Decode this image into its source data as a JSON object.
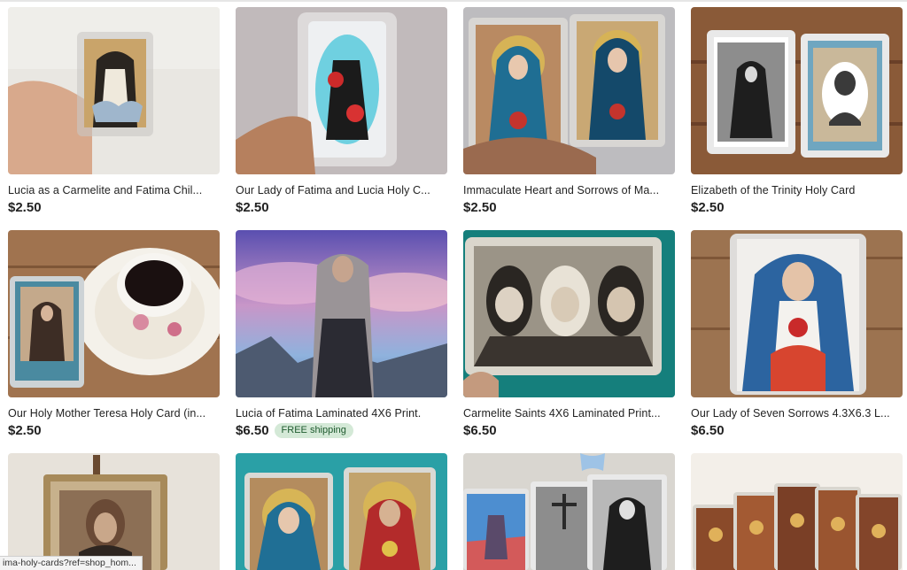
{
  "listings": [
    {
      "title": "Lucia as a Carmelite and Fatima Chil...",
      "price": "$2.50",
      "badge": "",
      "image": "holy-card-lucia-carmelite"
    },
    {
      "title": "Our Lady of Fatima and Lucia Holy C...",
      "price": "$2.50",
      "badge": "",
      "image": "holy-card-our-lady-of-fatima"
    },
    {
      "title": "Immaculate Heart and Sorrows of Ma...",
      "price": "$2.50",
      "badge": "",
      "image": "holy-card-immaculate-heart"
    },
    {
      "title": "Elizabeth of the Trinity Holy Card",
      "price": "$2.50",
      "badge": "",
      "image": "holy-card-elizabeth-trinity"
    },
    {
      "title": "Our Holy Mother Teresa Holy Card (in...",
      "price": "$2.50",
      "badge": "",
      "image": "holy-card-teresa-teacup"
    },
    {
      "title": "Lucia of Fatima Laminated 4X6 Print.",
      "price": "$6.50",
      "badge": "FREE shipping",
      "image": "print-lucia-of-fatima"
    },
    {
      "title": "Carmelite Saints 4X6 Laminated Print...",
      "price": "$6.50",
      "badge": "",
      "image": "print-carmelite-saints"
    },
    {
      "title": "Our Lady of Seven Sorrows 4.3X6.3 L...",
      "price": "$6.50",
      "badge": "",
      "image": "print-seven-sorrows"
    },
    {
      "title": "",
      "price": "",
      "badge": "",
      "image": "framed-portrait-card"
    },
    {
      "title": "",
      "price": "",
      "badge": "",
      "image": "holy-cards-mary-and-jesus"
    },
    {
      "title": "",
      "price": "",
      "badge": "",
      "image": "holy-cards-assorted"
    },
    {
      "title": "",
      "price": "",
      "badge": "",
      "image": "holy-cards-stations"
    }
  ],
  "status_bar": {
    "url": "ima-holy-cards?ref=shop_hom..."
  }
}
